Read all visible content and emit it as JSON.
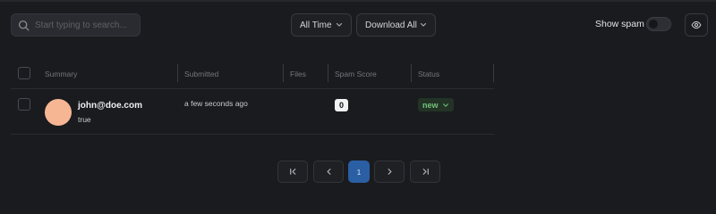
{
  "toolbar": {
    "search_placeholder": "Start typing to search...",
    "time_filter": "All Time",
    "download_label": "Download All",
    "show_spam_label": "Show spam",
    "show_spam_on": false
  },
  "table": {
    "columns": [
      "Summary",
      "Submitted",
      "Files",
      "Spam Score",
      "Status"
    ],
    "rows": [
      {
        "email": "john@doe.com",
        "subtext": "true",
        "submitted": "a few seconds ago",
        "files": "",
        "spam_score": "0",
        "status": "new"
      }
    ]
  },
  "pagination": {
    "current_page": "1"
  },
  "colors": {
    "background": "#1a1b1e",
    "accent": "#2b5fa4",
    "status_new": "#74c27a",
    "avatar": "#f6b694"
  }
}
